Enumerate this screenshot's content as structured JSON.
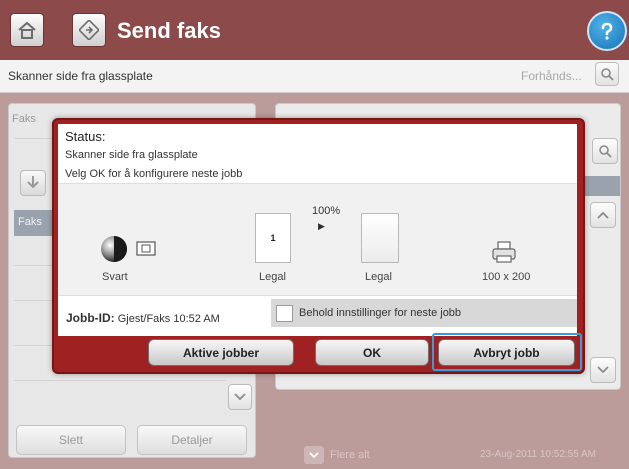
{
  "header": {
    "title": "Send faks",
    "home_icon": "home-icon",
    "fax_icon": "fax-icon",
    "help_icon": "help-icon",
    "bg_color": "#8c4a4a"
  },
  "subheader": {
    "status_text": "Skanner side fra glassplate",
    "preview_label": "Forhånds..."
  },
  "left_panel": {
    "faks_label": "Faks",
    "faks_tab": "Faks",
    "delete_button": "Slett",
    "details_button": "Detaljer"
  },
  "footer": {
    "more_label": "Flere alt",
    "timestamp": "23-Aug-2011 10:52:55 AM"
  },
  "dialog": {
    "status_title": "Status:",
    "status_line1": "Skanner side fra glassplate",
    "status_line2": "Velg OK for å konfigurere neste jobb",
    "zoom": "100%",
    "color_mode": "Svart",
    "source_page_number": "1",
    "source_size": "Legal",
    "dest_size": "Legal",
    "resolution": "100 x 200",
    "job_id_label": "Jobb-ID:",
    "job_id_value": "Gjest/Faks 10:52 AM",
    "keep_settings_label": "Behold innstillinger for neste jobb",
    "keep_settings_checked": false,
    "active_jobs_button": "Aktive jobber",
    "ok_button": "OK",
    "cancel_job_button": "Avbryt jobb",
    "accent_color": "#a02122",
    "highlight_color": "#3b9bd8"
  }
}
